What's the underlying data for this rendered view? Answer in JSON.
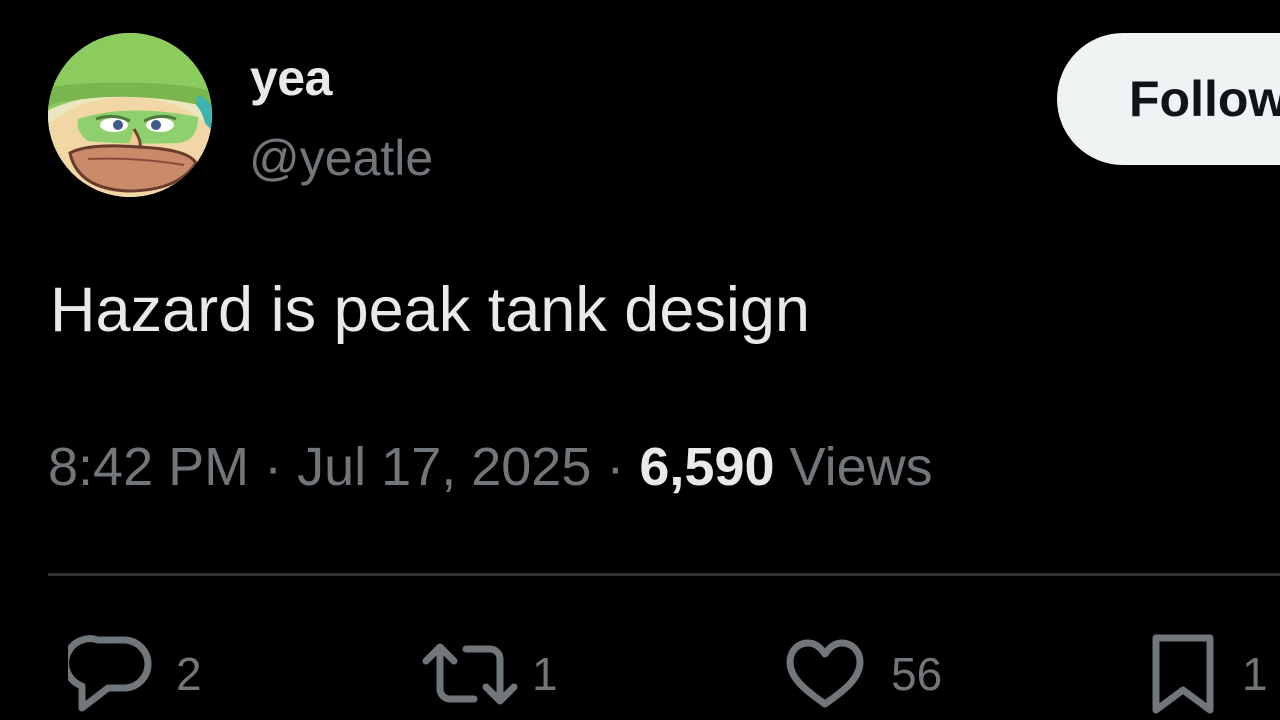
{
  "user": {
    "display_name": "yea",
    "handle": "@yeatle",
    "follow_label": "Follow"
  },
  "tweet": {
    "text": "Hazard is peak tank design",
    "time": "8:42 PM",
    "separator": "·",
    "date": "Jul 17, 2025",
    "views_count": "6,590",
    "views_label": "Views"
  },
  "actions": {
    "reply_count": "2",
    "retweet_count": "1",
    "like_count": "56",
    "bookmark_count": "1"
  },
  "icons": {
    "reply": "reply-icon",
    "retweet": "retweet-icon",
    "like": "heart-icon",
    "bookmark": "bookmark-icon"
  },
  "colors": {
    "background": "#000000",
    "primary_text": "#e7e9ea",
    "secondary_text": "#71767b",
    "divider": "#2f3336",
    "follow_button_bg": "#eff3f4",
    "follow_button_text": "#0f1419"
  }
}
